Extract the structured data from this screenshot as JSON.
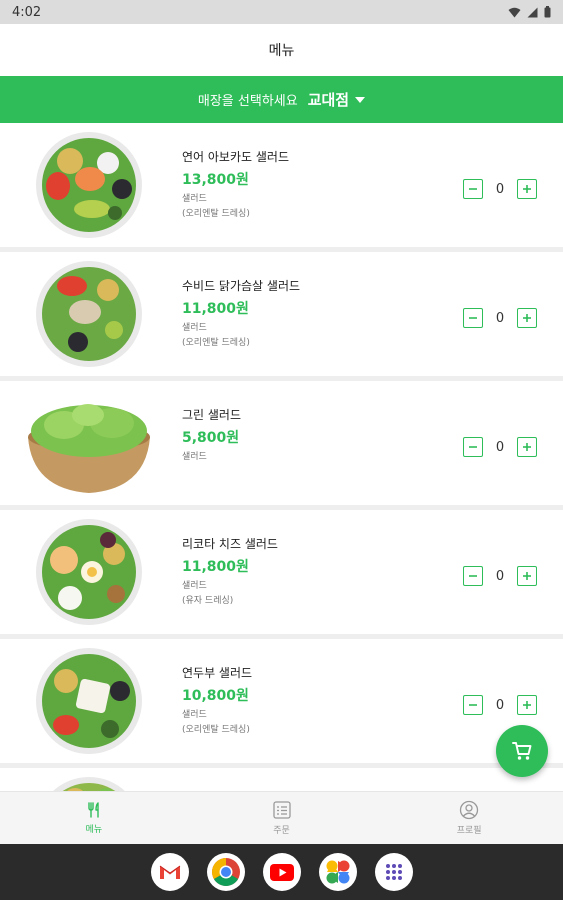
{
  "status_bar": {
    "time": "4:02"
  },
  "app_bar": {
    "title": "메뉴"
  },
  "store_bar": {
    "prompt": "매장을 선택하세요",
    "selected_store": "교대점"
  },
  "menu_items": [
    {
      "name": "연어 아보카도 샐러드",
      "price": "13,800원",
      "category": "샐러드",
      "dressing": "(오리엔탈 드레싱)",
      "quantity": "0"
    },
    {
      "name": "수비드 닭가슴살 샐러드",
      "price": "11,800원",
      "category": "샐러드",
      "dressing": "(오리엔탈 드레싱)",
      "quantity": "0"
    },
    {
      "name": "그린 샐러드",
      "price": "5,800원",
      "category": "샐러드",
      "dressing": "",
      "quantity": "0"
    },
    {
      "name": "리코타 치즈 샐러드",
      "price": "11,800원",
      "category": "샐러드",
      "dressing": "(유자 드레싱)",
      "quantity": "0"
    },
    {
      "name": "연두부 샐러드",
      "price": "10,800원",
      "category": "샐러드",
      "dressing": "(오리엔탈 드레싱)",
      "quantity": "0"
    }
  ],
  "fab": {
    "icon": "cart-icon"
  },
  "bottom_nav": [
    {
      "label": "메뉴",
      "icon": "fork-knife-icon",
      "active": true
    },
    {
      "label": "주문",
      "icon": "list-icon",
      "active": false
    },
    {
      "label": "프로필",
      "icon": "profile-icon",
      "active": false
    }
  ],
  "dock_apps": [
    "gmail-icon",
    "chrome-icon",
    "youtube-icon",
    "photos-icon",
    "app-drawer-icon"
  ],
  "colors": {
    "accent": "#2ebd59",
    "status_bar": "#dcdcdc",
    "system_nav": "#2b2b2b"
  }
}
